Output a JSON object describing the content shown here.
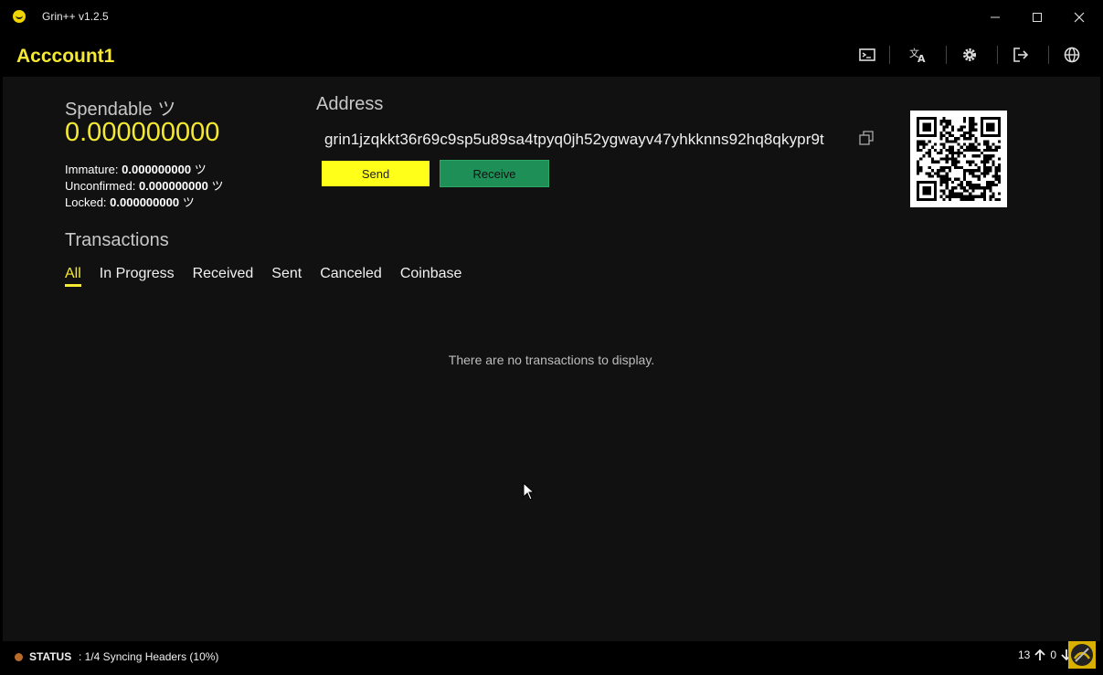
{
  "window": {
    "title": "Grin++ v1.2.5"
  },
  "header": {
    "account_name": "Acccount1",
    "icons": [
      "terminal-icon",
      "translate-icon",
      "gear-icon",
      "logout-icon",
      "globe-icon"
    ]
  },
  "balance": {
    "spendable_label": "Spendable ツ",
    "spendable_value": "0.000000000",
    "rows": [
      {
        "label": "Immature:",
        "value": "0.000000000",
        "unit": "ツ"
      },
      {
        "label": "Unconfirmed:",
        "value": "0.000000000",
        "unit": "ツ"
      },
      {
        "label": "Locked:",
        "value": "0.000000000",
        "unit": "ツ"
      }
    ]
  },
  "address": {
    "label": "Address",
    "value": "grin1jzqkkt36r69c9sp5u89sa4tpyq0jh52ygwayv47yhkknns92hq8qkypr9t",
    "send_label": "Send",
    "receive_label": "Receive"
  },
  "transactions": {
    "title": "Transactions",
    "tabs": [
      "All",
      "In Progress",
      "Received",
      "Sent",
      "Canceled",
      "Coinbase"
    ],
    "active_tab": "All",
    "empty_message": "There are no transactions to display."
  },
  "status": {
    "label": "STATUS",
    "text": ": 1/4 Syncing Headers (10%)",
    "peers_out": "13",
    "peers_in": "0"
  },
  "colors": {
    "accent": "#f5e932",
    "receive": "#1e8f57",
    "background": "#111111"
  }
}
